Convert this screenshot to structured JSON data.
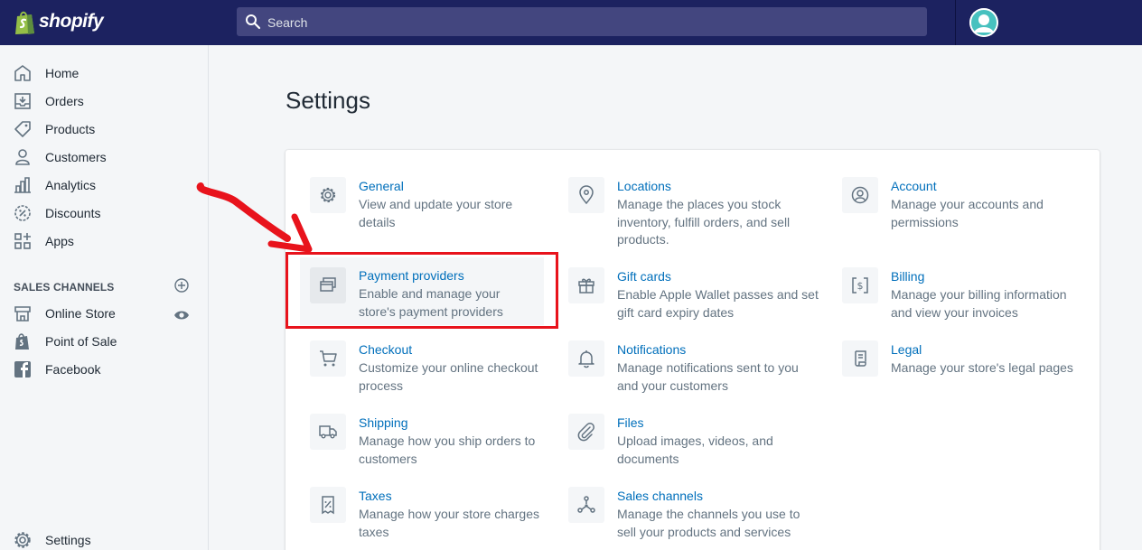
{
  "app": {
    "logo_text": "shopify"
  },
  "search": {
    "placeholder": "Search"
  },
  "sidebar": {
    "items": [
      {
        "label": "Home",
        "icon": "home-icon"
      },
      {
        "label": "Orders",
        "icon": "orders-icon"
      },
      {
        "label": "Products",
        "icon": "tag-icon"
      },
      {
        "label": "Customers",
        "icon": "person-icon"
      },
      {
        "label": "Analytics",
        "icon": "bar-chart-icon"
      },
      {
        "label": "Discounts",
        "icon": "discount-icon"
      },
      {
        "label": "Apps",
        "icon": "apps-icon"
      }
    ],
    "section_title": "SALES CHANNELS",
    "channels": [
      {
        "label": "Online Store",
        "icon": "store-icon"
      },
      {
        "label": "Point of Sale",
        "icon": "pos-bag-icon"
      },
      {
        "label": "Facebook",
        "icon": "facebook-icon"
      }
    ],
    "settings_label": "Settings"
  },
  "page": {
    "title": "Settings"
  },
  "settings": [
    {
      "title": "General",
      "desc": "View and update your store details",
      "icon": "gear-icon"
    },
    {
      "title": "Locations",
      "desc": "Manage the places you stock inventory, fulfill orders, and sell products.",
      "icon": "location-pin-icon"
    },
    {
      "title": "Account",
      "desc": "Manage your accounts and permissions",
      "icon": "account-icon"
    },
    {
      "title": "Payment providers",
      "desc": "Enable and manage your store's payment providers",
      "icon": "payment-icon"
    },
    {
      "title": "Gift cards",
      "desc": "Enable Apple Wallet passes and set gift card expiry dates",
      "icon": "gift-icon"
    },
    {
      "title": "Billing",
      "desc": "Manage your billing information and view your invoices",
      "icon": "billing-icon"
    },
    {
      "title": "Checkout",
      "desc": "Customize your online checkout process",
      "icon": "cart-icon"
    },
    {
      "title": "Notifications",
      "desc": "Manage notifications sent to you and your customers",
      "icon": "bell-icon"
    },
    {
      "title": "Legal",
      "desc": "Manage your store's legal pages",
      "icon": "legal-icon"
    },
    {
      "title": "Shipping",
      "desc": "Manage how you ship orders to customers",
      "icon": "truck-icon"
    },
    {
      "title": "Files",
      "desc": "Upload images, videos, and documents",
      "icon": "paperclip-icon"
    },
    {
      "title": "Taxes",
      "desc": "Manage how your store charges taxes",
      "icon": "tax-icon"
    },
    {
      "title": "Sales channels",
      "desc": "Manage the channels you use to sell your products and services",
      "icon": "channels-icon"
    }
  ],
  "colors": {
    "topbar": "#1c2260",
    "link": "#006fbb",
    "annotation": "#e8131c"
  }
}
